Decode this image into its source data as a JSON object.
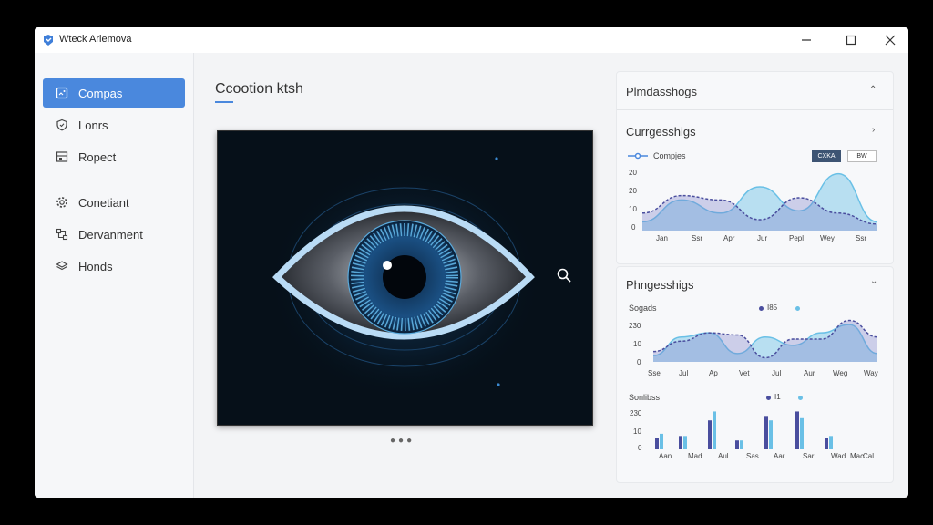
{
  "window": {
    "title": "Wteck Arlemova"
  },
  "sidebar": {
    "items": [
      {
        "label": "Compas",
        "icon": "image-icon",
        "active": true
      },
      {
        "label": "Lonrs",
        "icon": "shield-icon",
        "active": false
      },
      {
        "label": "Ropect",
        "icon": "layout-icon",
        "active": false
      },
      {
        "label": "Conetiant",
        "icon": "gear-icon",
        "active": false
      },
      {
        "label": "Dervanment",
        "icon": "flow-icon",
        "active": false
      },
      {
        "label": "Honds",
        "icon": "layers-icon",
        "active": false
      }
    ]
  },
  "main": {
    "title": "Ccootion ktsh"
  },
  "panel_top": {
    "header": "Plmdasshogs",
    "card_title": "Currgesshigs",
    "legend_label": "Compjes",
    "btn1": "CXKA",
    "btn2": "BW",
    "y_ticks": [
      "20",
      "20",
      "10",
      "0"
    ],
    "x_ticks": [
      "Jan",
      "Ssr",
      "Apr",
      "Jur",
      "Pepl",
      "Wey",
      "Ssr"
    ]
  },
  "panel_bottom": {
    "header": "Phngesshigs",
    "chart1": {
      "label": "Sogads",
      "legend1": "I85",
      "y_ticks": [
        "230",
        "10",
        "0"
      ],
      "x_ticks": [
        "Sse",
        "Jul",
        "Ap",
        "Vet",
        "Jul",
        "Aur",
        "Weg",
        "Way"
      ]
    },
    "chart2": {
      "label": "Sonlibss",
      "legend1": "I1",
      "y_ticks": [
        "230",
        "10",
        "0"
      ],
      "x_ticks": [
        "Aan",
        "Mad",
        "Aul",
        "Sas",
        "Aar",
        "Sar",
        "Wad",
        "Mac",
        "Cal"
      ]
    }
  },
  "colors": {
    "accent": "#4a88dd",
    "series_dark": "#4a4e9e",
    "series_light": "#6ac0e6"
  },
  "chart_data": [
    {
      "type": "area",
      "title": "Currgesshigs",
      "categories": [
        "Jan",
        "Ssr",
        "Apr",
        "Jur",
        "Pepl",
        "Wey",
        "Ssr"
      ],
      "series": [
        {
          "name": "Compjes",
          "values": [
            4,
            14,
            8,
            20,
            9,
            26,
            4
          ]
        },
        {
          "values": [
            8,
            16,
            14,
            5,
            15,
            8,
            3
          ]
        }
      ]
    },
    {
      "type": "area",
      "title": "Sogads",
      "categories": [
        "Sse",
        "Jul",
        "Ap",
        "Vet",
        "Jul",
        "Aur",
        "Weg",
        "Way"
      ],
      "series": [
        {
          "name": "I85",
          "values": [
            3,
            12,
            14,
            4,
            12,
            8,
            14,
            18,
            4
          ]
        },
        {
          "values": [
            5,
            10,
            14,
            13,
            2,
            11,
            11,
            20,
            12
          ]
        }
      ]
    },
    {
      "type": "bar",
      "title": "Sonlibss",
      "categories": [
        "Aan",
        "Mad",
        "Aul",
        "Sas",
        "Aar",
        "Sar",
        "Wad",
        "Mac",
        "Cal"
      ],
      "series": [
        {
          "name": "I1",
          "values": [
            5,
            6,
            13,
            4,
            15,
            17,
            5
          ]
        },
        {
          "values": [
            7,
            6,
            17,
            4,
            13,
            14,
            6
          ]
        }
      ]
    }
  ]
}
